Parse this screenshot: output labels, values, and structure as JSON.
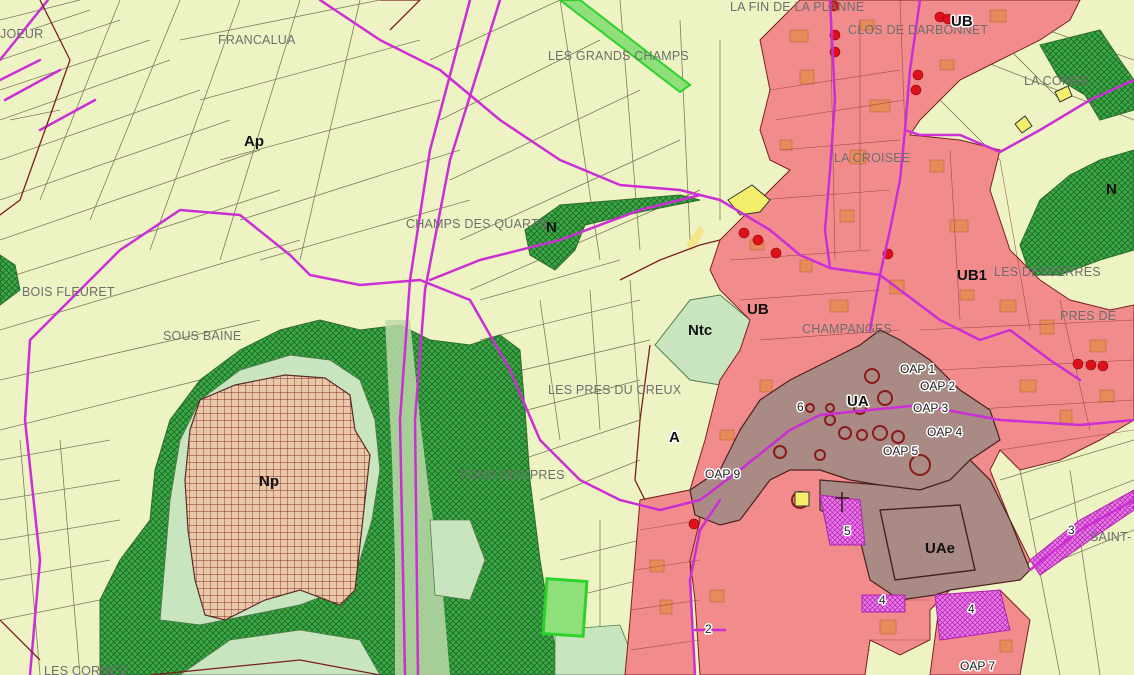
{
  "colors": {
    "agricultural_zone": "#eef3c4",
    "urban_zone": "#f28c8c",
    "historic_center": "#a98a84",
    "natural_zone": "#3aa845",
    "protected_zone": "#c8e5c0",
    "np_hatch": "#8a2b2b",
    "road": "#cc2ed6",
    "parcel_line": "#6f7050"
  },
  "place_labels": [
    "FRANCALUA",
    "LES GRANDS CHAMPS",
    "LA FIN DE LA PLANNE",
    "CLOS DE DARBONNET",
    "LA COMBE",
    "LA CROISEE",
    "CHAMPS DES QUARTS",
    "BOIS FLEURET",
    "SOUS BAINE",
    "LES PRES DU CREUX",
    "FOND DES PRES",
    "CHAMPANGES",
    "LES DESSERRES",
    "PRES DE",
    "SAINT-",
    "JOEUR",
    "LES CORNES"
  ],
  "zone_labels": [
    "Ap",
    "N",
    "N",
    "Ntc",
    "UB",
    "UB",
    "UB1",
    "UA",
    "A",
    "Np",
    "UAe"
  ],
  "oap_labels": [
    "OAP 1",
    "OAP 2",
    "OAP 3",
    "OAP 4",
    "OAP 5",
    "OAP 9",
    "OAP 7"
  ],
  "number_labels": [
    "6",
    "5",
    "4",
    "4",
    "3",
    "2"
  ],
  "icons": [
    "church-cross-icon",
    "heritage-point-icon"
  ]
}
